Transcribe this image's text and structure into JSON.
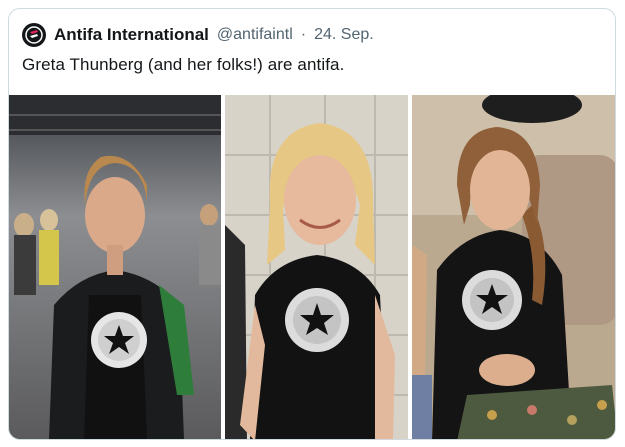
{
  "tweet": {
    "author_name": "Antifa International",
    "handle": "@antifaintl",
    "separator": "·",
    "date": "24. Sep.",
    "text": "Greta Thunberg (and her folks!) are antifa."
  },
  "colors": {
    "text_primary": "#14171a",
    "text_secondary": "#536471",
    "border": "#cfd9de"
  },
  "photos": {
    "shirt_text_1": "ANTIFASCIST",
    "shirt_text_2": "ALL STARS"
  }
}
